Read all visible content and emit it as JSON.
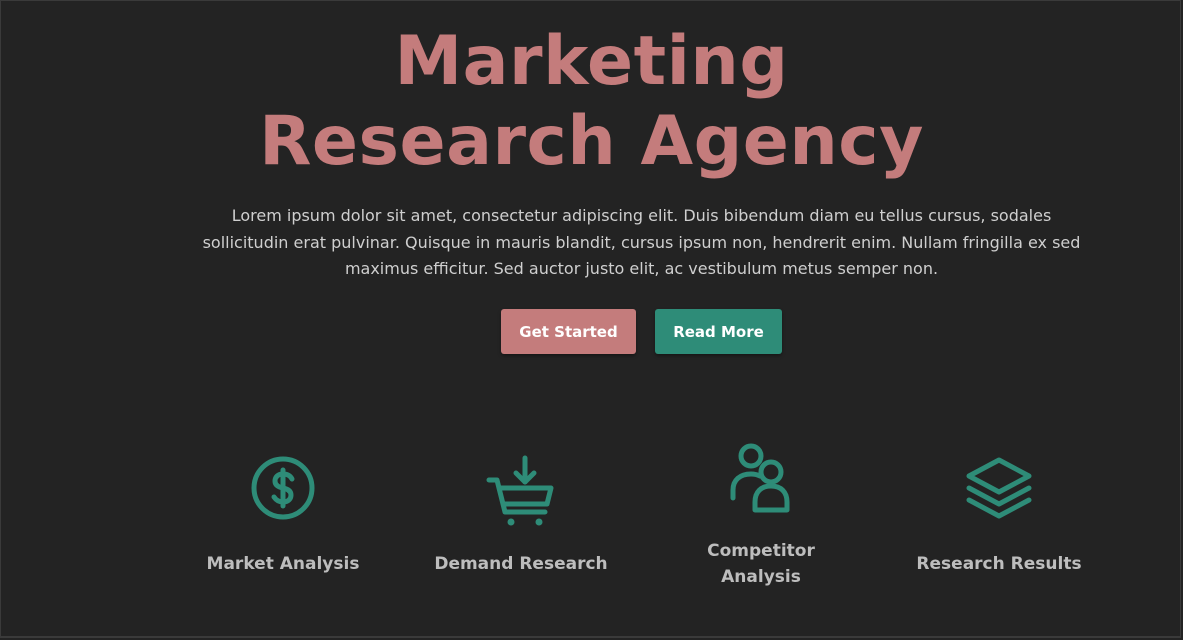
{
  "hero": {
    "title_line1": "Marketing",
    "title_line2": "Research Agency",
    "description": "Lorem ipsum dolor sit amet, consectetur adipiscing elit. Duis bibendum diam eu tellus cursus, sodales sollicitudin erat pulvinar. Quisque in mauris blandit, cursus ipsum non, hendrerit enim. Nullam fringilla ex sed maximus efficitur. Sed auctor justo elit, ac vestibulum metus semper non."
  },
  "buttons": {
    "primary_label": "Get Started",
    "secondary_label": "Read More"
  },
  "features": [
    {
      "label": "Market Analysis",
      "icon": "dollar-circle-icon"
    },
    {
      "label": "Demand Research",
      "icon": "cart-download-icon"
    },
    {
      "label_line1": "Competitor",
      "label_line2": "Analysis",
      "icon": "users-icon"
    },
    {
      "label": "Research Results",
      "icon": "layers-icon"
    }
  ],
  "colors": {
    "background": "#232323",
    "accent_pink": "#c47c7c",
    "accent_teal": "#2e8c78",
    "text_light": "#cfcfcf",
    "label_gray": "#bdbdbd"
  }
}
